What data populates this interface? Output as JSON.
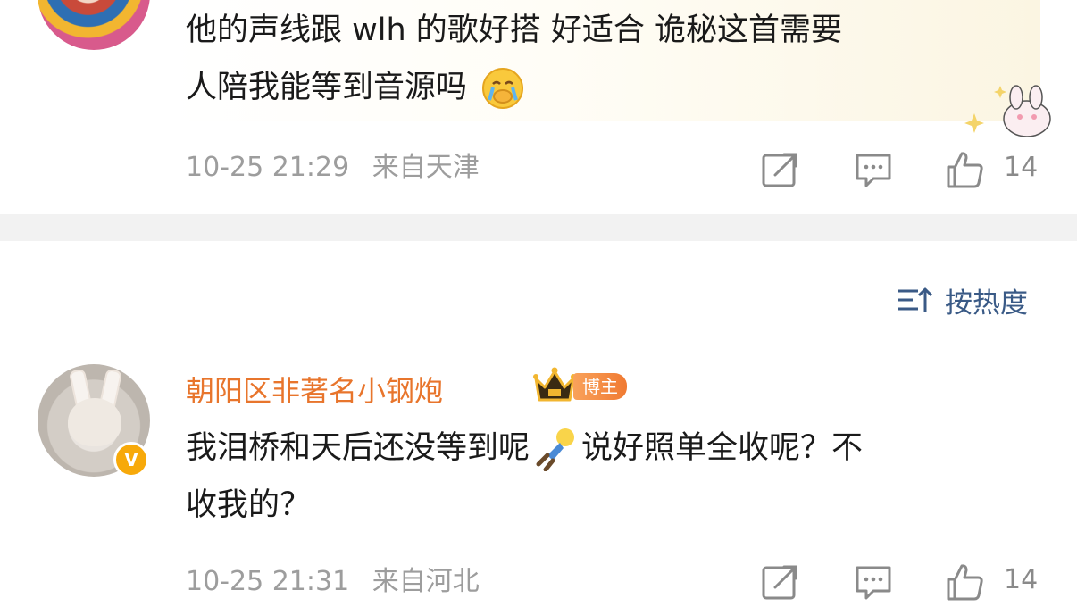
{
  "comments": [
    {
      "text_line1": "他的声线跟 wlh 的歌好搭 好适合 诡秘这首需要",
      "text_line2": "人陪我能等到音源吗",
      "emoji": "crying-face-emoji",
      "time": "10-25 21:29",
      "location": "来自天津",
      "likes": "14"
    },
    {
      "username": "朝阳区非著名小钢炮",
      "role_badge": "博主",
      "verified_mark": "V",
      "text_part1": "我泪桥和天后还没等到呢",
      "emoji": "falling-person-emoji",
      "text_part2": "说好照单全收呢？不",
      "text_line2": "收我的？",
      "time": "10-25 21:31",
      "location": "来自河北",
      "likes": "14"
    }
  ],
  "sort": {
    "label": "按热度",
    "icon": "sort-icon"
  },
  "colors": {
    "username": "#e8752c",
    "meta": "#9d9d9d",
    "sort": "#3a5a86",
    "divider": "#f2f2f2",
    "verified": "#f7a90a"
  }
}
